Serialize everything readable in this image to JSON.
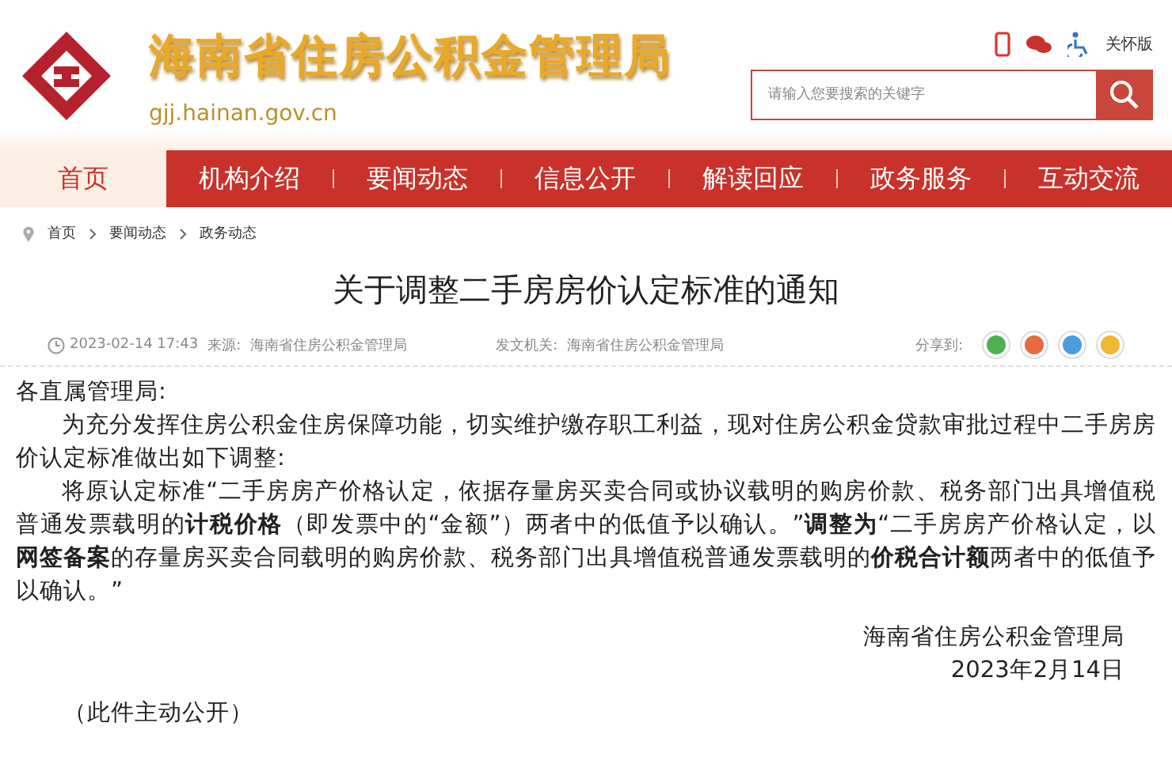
{
  "header": {
    "site_title": "海南省住房公积金管理局",
    "domain": "gjj.hainan.gov.cn",
    "care_mode": "关怀版",
    "search": {
      "placeholder": "请输入您要搜索的关键字"
    }
  },
  "nav": [
    {
      "label": "首页",
      "selected": true
    },
    {
      "label": "机构介绍",
      "selected": false
    },
    {
      "label": "要闻动态",
      "selected": false
    },
    {
      "label": "信息公开",
      "selected": false
    },
    {
      "label": "解读回应",
      "selected": false
    },
    {
      "label": "政务服务",
      "selected": false
    },
    {
      "label": "互动交流",
      "selected": false
    }
  ],
  "breadcrumb": [
    "首页",
    "要闻动态",
    "政务动态"
  ],
  "article": {
    "title": "关于调整二手房房价认定标准的通知",
    "date": "2023-02-14 17:43",
    "source_label": "来源:",
    "source": "海南省住房公积金管理局",
    "issuer_label": "发文机关:",
    "issuer": "海南省住房公积金管理局",
    "share_label": "分享到:",
    "salutation": "各直属管理局:",
    "paragraphs": [
      "为充分发挥住房公积金住房保障功能，切实维护缴存职工利益，现对住房公积金贷款审批过程中二手房房价认定标准做出如下调整:",
      "将原认定标准“二手房房产价格认定，依据存量房买卖合同或协议载明的购房价款、税务部门出具增值税普通发票载明的**计税价格**（即发票中的“金额”）两者中的低值予以确认。”**调整为**“二手房房产价格认定，以**网签备案**的存量房买卖合同载明的购房价款、税务部门出具增值税普通发票载明的**价税合计额**两者中的低值予以确认。”"
    ],
    "signature": "海南省住房公积金管理局",
    "sign_date": "2023年2月14日",
    "note": "（此件主动公开）"
  }
}
